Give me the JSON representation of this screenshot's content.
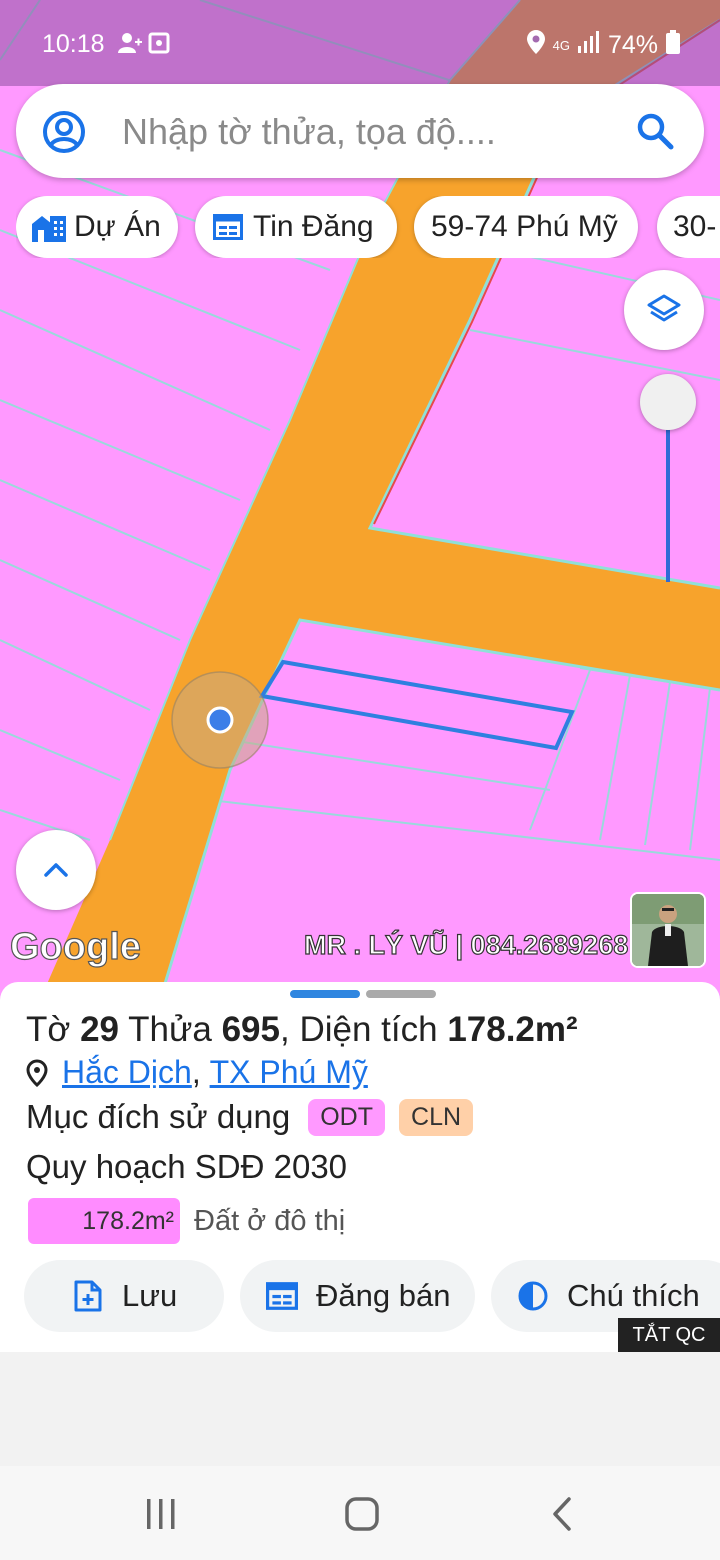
{
  "status_bar": {
    "time": "10:18",
    "network": "4G",
    "battery": "74%"
  },
  "search": {
    "placeholder": "Nhập tờ thửa, tọa độ...."
  },
  "chips": [
    {
      "label": "Dự Án",
      "icon": "building-icon"
    },
    {
      "label": "Tin Đăng",
      "icon": "listing-icon"
    },
    {
      "label": "59-74 Phú Mỹ",
      "icon": ""
    },
    {
      "label": "30-",
      "icon": ""
    }
  ],
  "map": {
    "attribution": "Google",
    "watermark": "MR . LÝ VŨ | 084.2689268",
    "colors": {
      "land": "#ff99ff",
      "road": "#f7a32c",
      "parcel_outline": "#2f7fe0",
      "boundary": "#8fe0d8"
    }
  },
  "parcel_info": {
    "title": {
      "sheet_label": "Tờ",
      "sheet_no": "29",
      "plot_label": "Thửa",
      "plot_no": "695",
      "area_label": ", Diện tích",
      "area": "178.2m²"
    },
    "location": {
      "ward": "Hắc Dịch",
      "separator": ",",
      "town": "TX Phú Mỹ"
    },
    "purpose_label": "Mục đích sử dụng",
    "purpose_tags": [
      {
        "code": "ODT",
        "color": "#ff99ff"
      },
      {
        "code": "CLN",
        "color": "#ffd0a8"
      }
    ],
    "plan_label": "Quy hoạch SDĐ 2030",
    "plan_area": "178.2m²",
    "plan_type": "Đất ở đô thị"
  },
  "actions": [
    {
      "label": "Lưu",
      "icon": "save-file-icon"
    },
    {
      "label": "Đăng bán",
      "icon": "listing-icon"
    },
    {
      "label": "Chú thích",
      "icon": "contrast-icon"
    }
  ],
  "ad_toggle": "TẮT QC"
}
